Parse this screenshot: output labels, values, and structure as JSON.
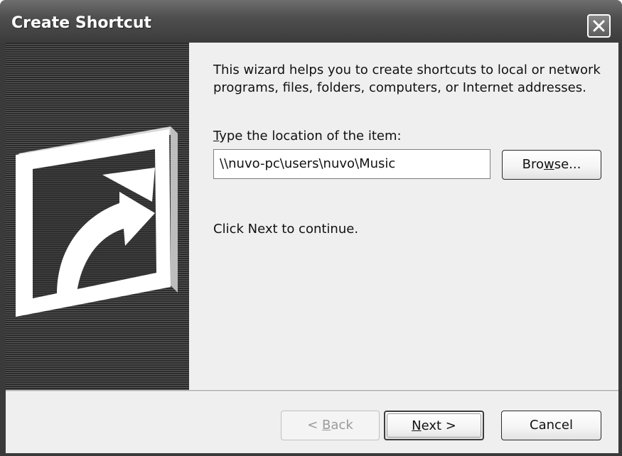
{
  "window": {
    "title": "Create Shortcut"
  },
  "wizard": {
    "intro": "This wizard helps you to create shortcuts to local or network programs, files, folders, computers, or Internet addresses.",
    "location_label_mnemonic": "T",
    "location_label_rest": "ype the location of the item:",
    "location_value": "\\\\nuvo-pc\\users\\nuvo\\Music",
    "browse_mnemonic": "w",
    "browse_pre": "Bro",
    "browse_post": "se...",
    "next_hint": "Click Next to continue."
  },
  "footer": {
    "back_pre": "< ",
    "back_mnemonic": "B",
    "back_post": "ack",
    "next_mnemonic": "N",
    "next_post": "ext >",
    "cancel_label": "Cancel"
  },
  "icons": {
    "close": "close-icon",
    "shortcut": "shortcut-arrow-icon"
  }
}
